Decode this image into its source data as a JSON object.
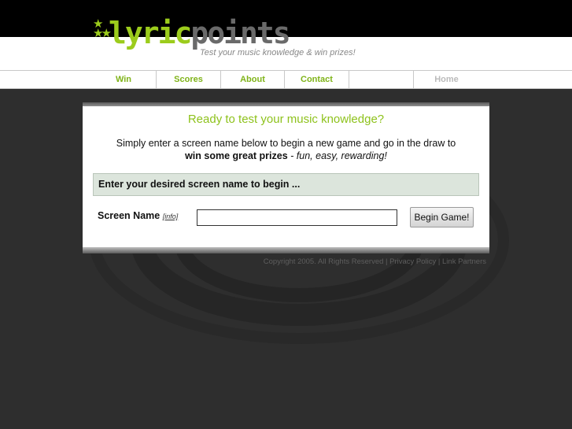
{
  "header": {
    "logo_lyric": "lyric",
    "logo_points": "points",
    "tagline": "Test your music knowledge & win prizes!"
  },
  "nav": {
    "win": "Win",
    "scores": "Scores",
    "about": "About",
    "contact": "Contact",
    "home": "Home"
  },
  "panel": {
    "heading": "Ready to test your music knowledge?",
    "intro_line1": "Simply enter a screen name below to begin a new game and go in the draw to",
    "intro_bold": "win some great prizes",
    "intro_italic": " - fun, easy, rewarding!",
    "instruction": "Enter your desired screen name to begin ...",
    "field_label": "Screen Name",
    "info_link": "[info]",
    "input_value": "",
    "button_label": "Begin Game!"
  },
  "footer": {
    "copyright": "Copyright 2005. All Rights Reserved",
    "sep1": " | ",
    "privacy": "Privacy Policy",
    "sep2": " | ",
    "partners": "Link Partners"
  },
  "colors": {
    "accent": "#8ec21c",
    "background": "#2e2e2e"
  },
  "icons": {
    "logo_stars": "star-cluster-icon"
  }
}
